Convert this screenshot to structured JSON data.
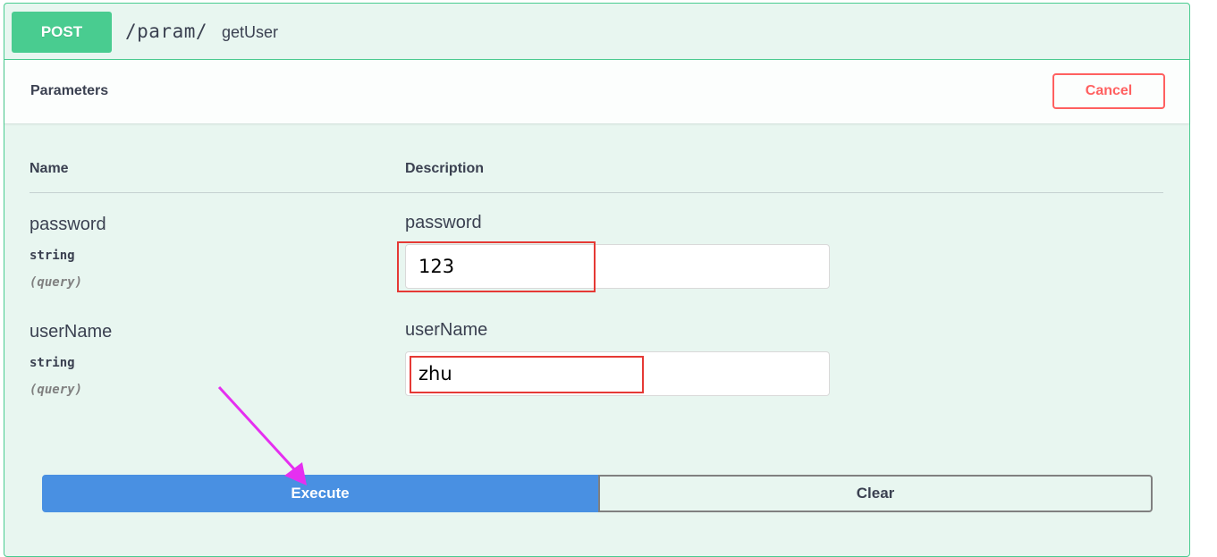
{
  "operation": {
    "method": "POST",
    "path": "/param/",
    "summary": "getUser",
    "method_color": "#49cc90"
  },
  "parameters_section": {
    "title": "Parameters",
    "cancel_label": "Cancel"
  },
  "table": {
    "headers": [
      "Name",
      "Description"
    ]
  },
  "params": [
    {
      "name": "password",
      "type": "string",
      "in": "(query)",
      "description": "password",
      "value": "123"
    },
    {
      "name": "userName",
      "type": "string",
      "in": "(query)",
      "description": "userName",
      "value": "zhu"
    }
  ],
  "actions": {
    "execute_label": "Execute",
    "clear_label": "Clear",
    "execute_color": "#4990e2"
  },
  "annotations": {
    "highlight_color": "#e53935",
    "arrow_color": "#e52ff0"
  }
}
